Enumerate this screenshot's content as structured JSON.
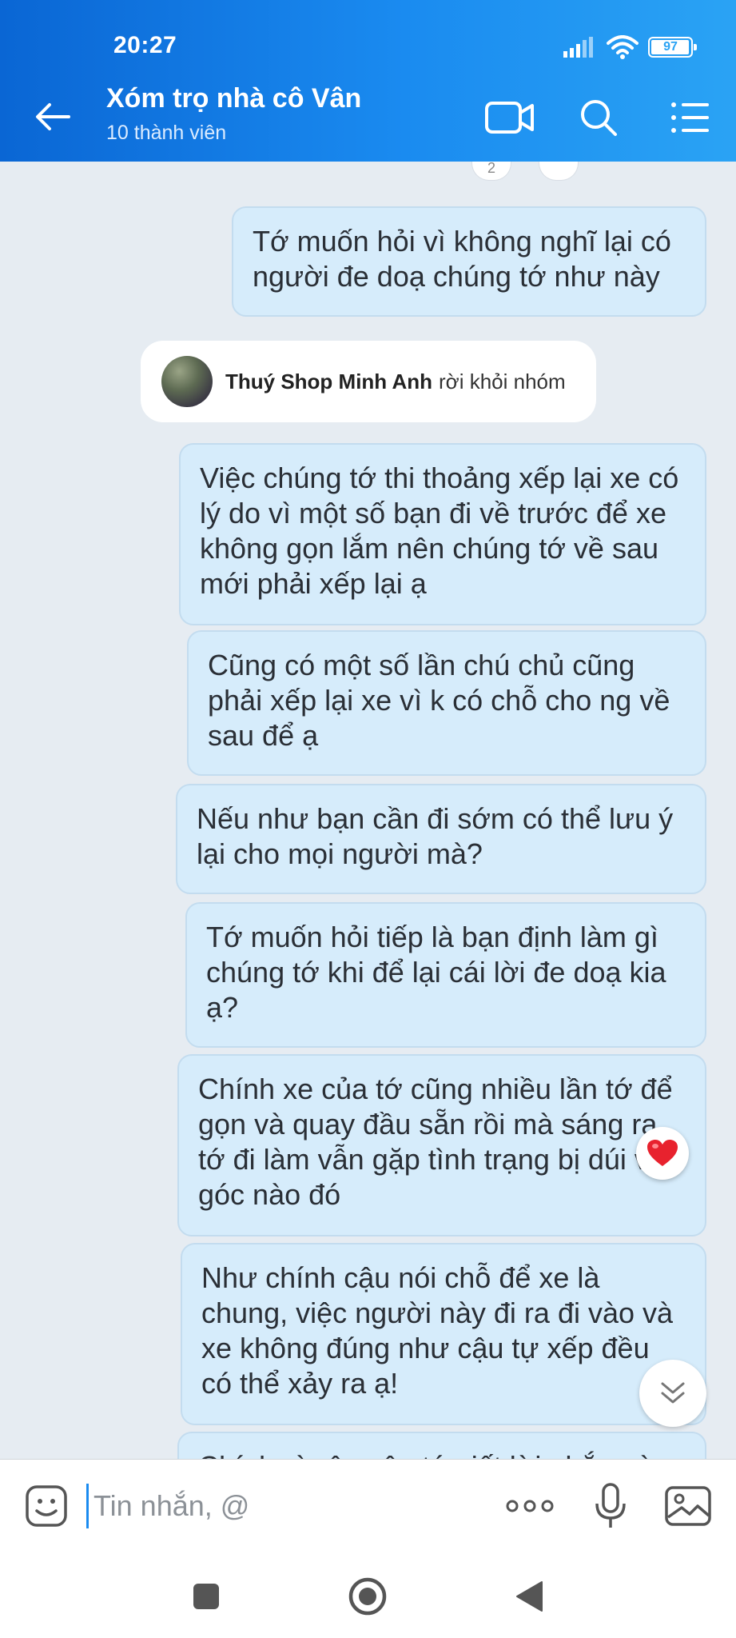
{
  "status": {
    "time": "20:27",
    "battery": "97",
    "battery_level_percent": 97
  },
  "header": {
    "title": "Xóm trọ nhà cô Vân",
    "subtitle": "10 thành viên",
    "icons": [
      "back-arrow-icon",
      "video-call-icon",
      "search-icon",
      "menu-list-icon"
    ]
  },
  "reactions": {
    "count": "2"
  },
  "messages": [
    {
      "text": "Tớ muốn hỏi vì không nghĩ lại có người đe doạ chúng tớ như này"
    },
    {
      "text": "Việc chúng tớ thi thoảng xếp lại xe có lý do vì một số bạn đi về trước để xe không gọn lắm nên chúng tớ về sau mới phải xếp lại ạ"
    },
    {
      "text": "Cũng có một số lần chú chủ cũng phải xếp lại xe vì k có chỗ cho ng về sau để ạ"
    },
    {
      "text": "Nếu như bạn cần đi sớm có thể lưu ý lại cho mọi người mà?"
    },
    {
      "text": "Tớ muốn hỏi tiếp là bạn định làm gì chúng tớ khi để lại cái lời đe doạ kia ạ?"
    },
    {
      "text": "Chính xe của tớ cũng nhiều lần tớ để gọn và quay đầu sẵn rồi mà sáng ra tớ đi làm vẫn gặp tình trạng bị dúi vô góc nào đó"
    },
    {
      "text": "Như chính cậu nói chỗ để xe là chung, việc người này đi ra đi vào và xe không đúng như cậu tự xếp đều có thể xảy ra ạ!"
    },
    {
      "text": "Chính vì vậy nên tớ viết lời nhắn này mới phải"
    }
  ],
  "system_message": {
    "name": "Thuý Shop Minh Anh",
    "action": "rời khỏi nhóm"
  },
  "input": {
    "placeholder": "Tin nhắn, @"
  },
  "colors": {
    "header_start": "#0a66d4",
    "header_end": "#2aa3f4",
    "bubble": "#d6ecfb",
    "background": "#e6ecf2",
    "heart": "#e8222e"
  }
}
